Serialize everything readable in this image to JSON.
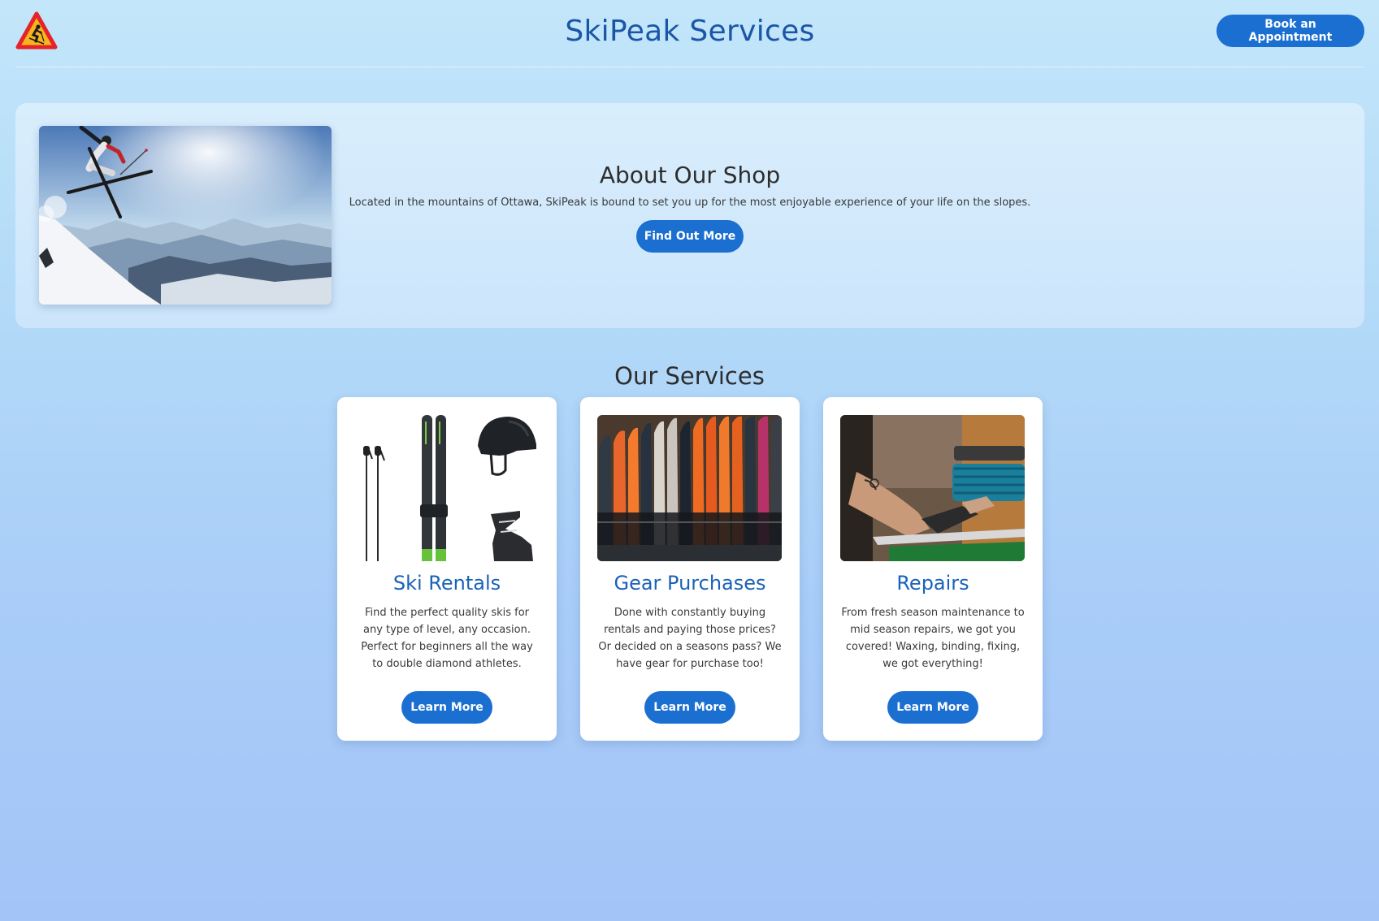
{
  "header": {
    "logo_icon": "ski-warning-sign-icon",
    "title": "SkiPeak Services",
    "book_button": "Book an Appointment"
  },
  "about": {
    "image": "skier-jumping-mountain-photo",
    "title": "About Our Shop",
    "description": "Located in the mountains of Ottawa, SkiPeak is bound to set you up for the most enjoyable experience of your life on the slopes.",
    "button": "Find Out More"
  },
  "services": {
    "title": "Our Services",
    "cards": [
      {
        "image": "ski-equipment-photo",
        "title": "Ski Rentals",
        "description": "Find the perfect quality skis for any type of level, any occasion. Perfect for beginners all the way to double diamond athletes.",
        "button": "Learn More"
      },
      {
        "image": "ski-rack-photo",
        "title": "Gear Purchases",
        "description": "Done with constantly buying rentals and paying those prices? Or decided on a seasons pass? We have gear for purchase too!",
        "button": "Learn More"
      },
      {
        "image": "ski-repair-photo",
        "title": "Repairs",
        "description": "From fresh season maintenance to mid season repairs, we got you covered! Waxing, binding, fixing, we got everything!",
        "button": "Learn More"
      }
    ]
  },
  "colors": {
    "accent": "#1b6fd1",
    "title_blue": "#1a56a6",
    "card_title_blue": "#1a62b8"
  }
}
